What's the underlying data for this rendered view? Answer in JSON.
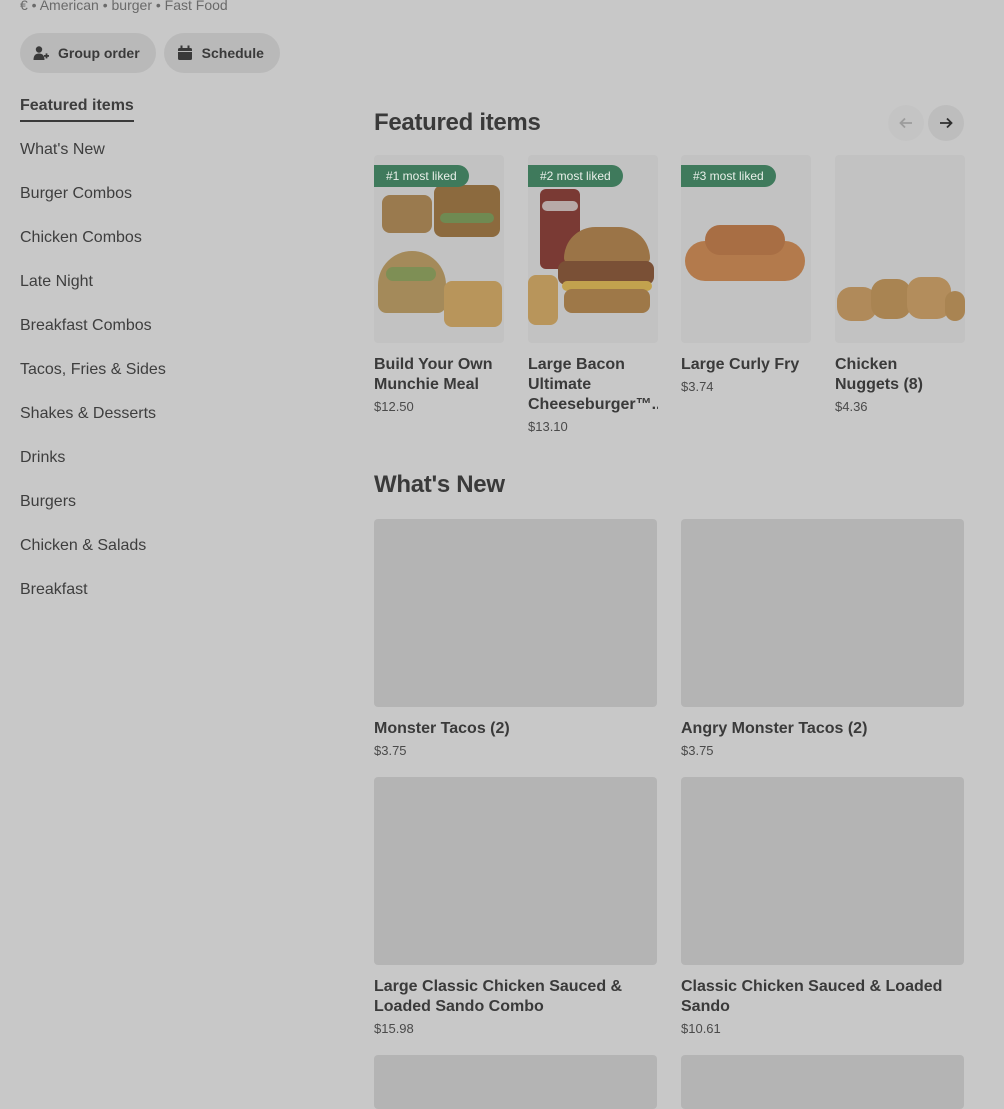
{
  "store": {
    "meta": "€ • American • burger • Fast Food",
    "group_order_label": "Group order",
    "schedule_label": "Schedule"
  },
  "sidebar": {
    "items": [
      {
        "label": "Featured items",
        "active": true
      },
      {
        "label": "What's New"
      },
      {
        "label": "Burger Combos"
      },
      {
        "label": "Chicken Combos"
      },
      {
        "label": "Late Night"
      },
      {
        "label": "Breakfast Combos"
      },
      {
        "label": "Tacos, Fries & Sides"
      },
      {
        "label": "Shakes & Desserts"
      },
      {
        "label": "Drinks"
      },
      {
        "label": "Burgers"
      },
      {
        "label": "Chicken & Salads"
      },
      {
        "label": "Breakfast"
      }
    ]
  },
  "featured": {
    "title": "Featured items",
    "items": [
      {
        "badge": "#1 most liked",
        "title": "Build Your Own Munchie Meal",
        "price": "$12.50"
      },
      {
        "badge": "#2 most liked",
        "title": "Large Bacon Ultimate Cheeseburger™...",
        "price": "$13.10"
      },
      {
        "badge": "#3 most liked",
        "title": "Large Curly Fry",
        "price": "$3.74"
      },
      {
        "badge": "",
        "title": "Chicken Nuggets (8)",
        "price": "$4.36"
      }
    ]
  },
  "whats_new": {
    "title": "What's New",
    "items": [
      {
        "title": "Monster Tacos (2)",
        "price": "$3.75"
      },
      {
        "title": "Angry Monster Tacos (2)",
        "price": "$3.75"
      },
      {
        "title": "Large Classic Chicken Sauced & Loaded Sando Combo",
        "price": "$15.98"
      },
      {
        "title": "Classic Chicken Sauced & Loaded Sando",
        "price": "$10.61"
      }
    ]
  },
  "colors": {
    "overlay_bg": "#c8c8c8",
    "badge_green": "#3f7a5c"
  }
}
